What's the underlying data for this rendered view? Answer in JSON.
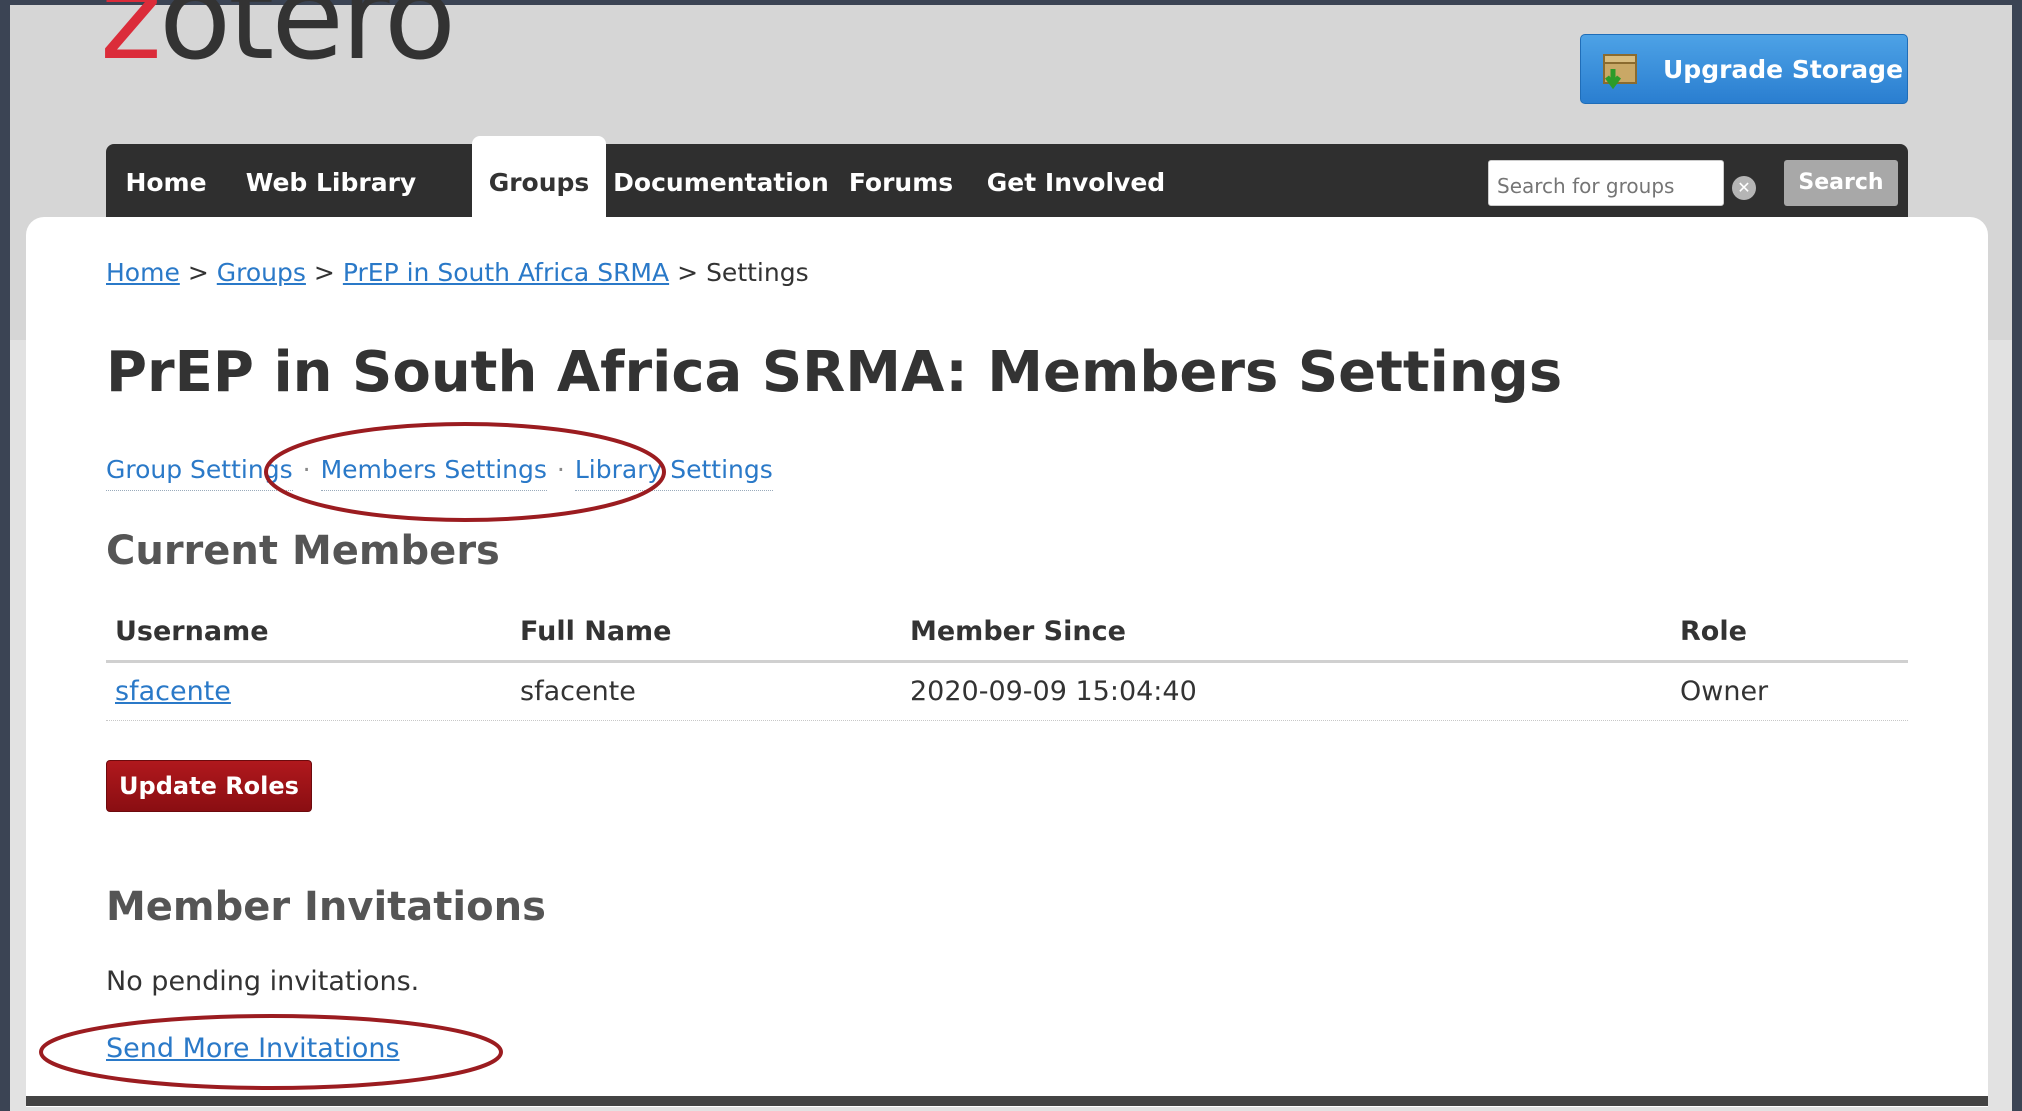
{
  "logo": {
    "first_letter": "z",
    "rest": "otero"
  },
  "header": {
    "upgrade_label": "Upgrade Storage"
  },
  "nav": {
    "items": [
      "Home",
      "Web Library",
      "Groups",
      "Documentation",
      "Forums",
      "Get Involved"
    ],
    "active": "Groups"
  },
  "search": {
    "placeholder": "Search for groups",
    "button_label": "Search"
  },
  "breadcrumb": {
    "home": "Home",
    "groups": "Groups",
    "group": "PrEP in South Africa SRMA",
    "current": "Settings",
    "separator": ">"
  },
  "page": {
    "title": "PrEP in South Africa SRMA: Members Settings"
  },
  "settings_links": {
    "group": "Group Settings",
    "members": "Members Settings",
    "library": "Library Settings",
    "separator": "·"
  },
  "members": {
    "heading": "Current Members",
    "columns": [
      "Username",
      "Full Name",
      "Member Since",
      "Role"
    ],
    "rows": [
      {
        "username": "sfacente",
        "full_name": "sfacente",
        "member_since": "2020-09-09 15:04:40",
        "role": "Owner"
      }
    ],
    "update_button": "Update Roles"
  },
  "invitations": {
    "heading": "Member Invitations",
    "status": "No pending invitations.",
    "send_link": "Send More Invitations"
  },
  "colors": {
    "link": "#2a79c8",
    "nav_bg": "#2f2f2f",
    "logo_accent": "#db2c3a",
    "primary_button": "#9b1216",
    "annotation": "#9b1c20",
    "upgrade_button": "#2f87d8"
  },
  "icons": {
    "upgrade": "storage-box-icon",
    "clear": "clear-search-icon"
  }
}
